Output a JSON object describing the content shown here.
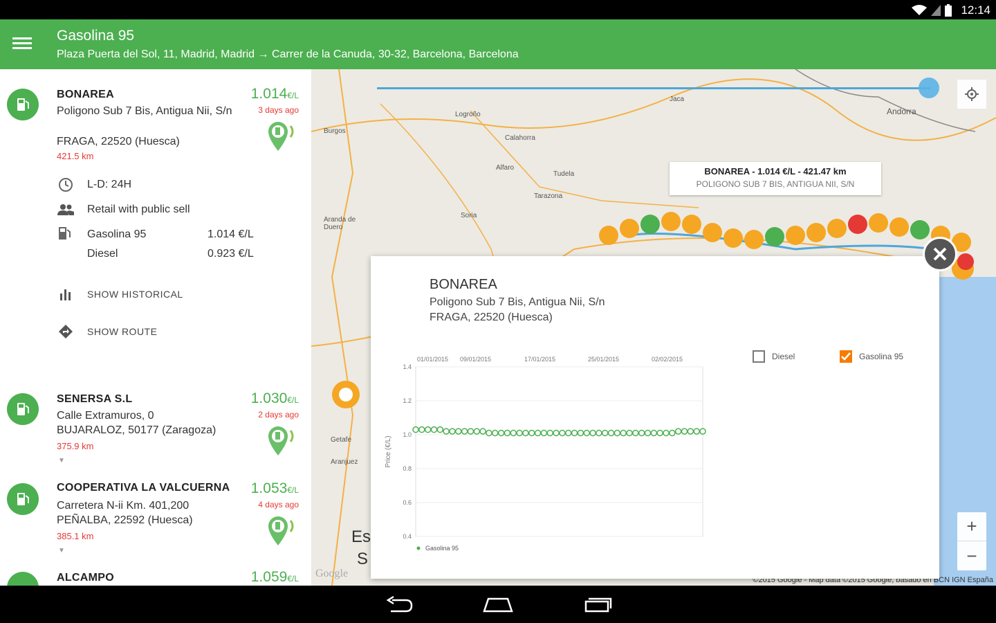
{
  "status": {
    "time": "12:14"
  },
  "app_bar": {
    "title": "Gasolina 95",
    "subtitle": "Plaza Puerta del Sol, 11,  Madrid, Madrid → Carrer de la Canuda, 30-32,  Barcelona, Barcelona"
  },
  "stations": [
    {
      "name": "BONAREA",
      "address": "Poligono Sub 7 Bis, Antigua Nii, S/n",
      "city": "FRAGA, 22520 (Huesca)",
      "distance": "421.5 km",
      "price": "1.014",
      "price_unit": "€/L",
      "ago": "3 days ago",
      "hours": "L-D: 24H",
      "sale_type": "Retail with public sell",
      "fuels": [
        {
          "name": "Gasolina 95",
          "price": "1.014 €/L"
        },
        {
          "name": "Diesel",
          "price": "0.923 €/L"
        }
      ],
      "show_historical": "SHOW HISTORICAL",
      "show_route": "SHOW ROUTE"
    },
    {
      "name": "SENERSA S.L",
      "address": "Calle Extramuros, 0",
      "city": "BUJARALOZ, 50177 (Zaragoza)",
      "distance": "375.9 km",
      "price": "1.030",
      "price_unit": "€/L",
      "ago": "2 days ago"
    },
    {
      "name": "COOPERATIVA LA VALCUERNA",
      "address": "Carretera N-ii Km. 401,200",
      "city": "PEÑALBA, 22592 (Huesca)",
      "distance": "385.1 km",
      "price": "1.053",
      "price_unit": "€/L",
      "ago": "4 days ago"
    },
    {
      "name": "ALCAMPO",
      "price": "1.059",
      "price_unit": "€/L"
    }
  ],
  "map": {
    "tooltip_title": "BONAREA - 1.014 €/L - 421.47 km",
    "tooltip_sub": "POLIGONO SUB 7 BIS, ANTIGUA NII, S/N",
    "copyright": "©2015 Google - Map data ©2015 Google, basado en BCN IGN España",
    "google": "Google",
    "labels": [
      "Logroño",
      "Burgos",
      "Calahorra",
      "Alfaro",
      "Tudela",
      "Tarazona",
      "Soria",
      "Aranda de Duero",
      "Jaca",
      "Andorra",
      "Getafe",
      "Aranjuez",
      "Es",
      "S"
    ],
    "zoom_in": "+",
    "zoom_out": "−"
  },
  "dialog": {
    "title": "BONAREA",
    "address": "Poligono Sub 7 Bis, Antigua Nii, S/n",
    "city": "FRAGA, 22520 (Huesca)",
    "legend_diesel": "Diesel",
    "legend_gasolina": "Gasolina 95",
    "diesel_checked": false,
    "gasolina_checked": true
  },
  "chart_data": {
    "type": "line",
    "ylabel": "Price (€/L)",
    "ylim": [
      0.4,
      1.4
    ],
    "yticks": [
      "1.4",
      "1.2",
      "1.0",
      "0.8",
      "0.6",
      "0.4"
    ],
    "xtick_labels": [
      "01/01/2015",
      "09/01/2015",
      "17/01/2015",
      "25/01/2015",
      "02/02/2015"
    ],
    "series": [
      {
        "name": "Gasolina 95",
        "color": "#4caf50",
        "values": [
          1.03,
          1.03,
          1.03,
          1.03,
          1.03,
          1.02,
          1.02,
          1.02,
          1.02,
          1.02,
          1.02,
          1.02,
          1.01,
          1.01,
          1.01,
          1.01,
          1.01,
          1.01,
          1.01,
          1.01,
          1.01,
          1.01,
          1.01,
          1.01,
          1.01,
          1.01,
          1.01,
          1.01,
          1.01,
          1.01,
          1.01,
          1.01,
          1.01,
          1.01,
          1.01,
          1.01,
          1.01,
          1.01,
          1.01,
          1.01,
          1.01,
          1.01,
          1.01,
          1.02,
          1.02,
          1.02,
          1.02,
          1.02
        ]
      }
    ]
  }
}
